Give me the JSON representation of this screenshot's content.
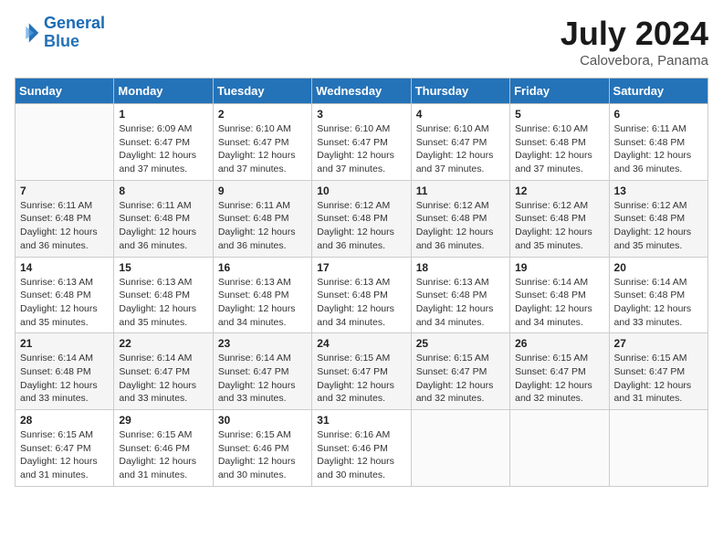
{
  "header": {
    "logo_line1": "General",
    "logo_line2": "Blue",
    "month": "July 2024",
    "location": "Calovebora, Panama"
  },
  "days_of_week": [
    "Sunday",
    "Monday",
    "Tuesday",
    "Wednesday",
    "Thursday",
    "Friday",
    "Saturday"
  ],
  "weeks": [
    [
      {
        "day": "",
        "sunrise": "",
        "sunset": "",
        "daylight": ""
      },
      {
        "day": "1",
        "sunrise": "6:09 AM",
        "sunset": "6:47 PM",
        "daylight": "12 hours and 37 minutes."
      },
      {
        "day": "2",
        "sunrise": "6:10 AM",
        "sunset": "6:47 PM",
        "daylight": "12 hours and 37 minutes."
      },
      {
        "day": "3",
        "sunrise": "6:10 AM",
        "sunset": "6:47 PM",
        "daylight": "12 hours and 37 minutes."
      },
      {
        "day": "4",
        "sunrise": "6:10 AM",
        "sunset": "6:47 PM",
        "daylight": "12 hours and 37 minutes."
      },
      {
        "day": "5",
        "sunrise": "6:10 AM",
        "sunset": "6:48 PM",
        "daylight": "12 hours and 37 minutes."
      },
      {
        "day": "6",
        "sunrise": "6:11 AM",
        "sunset": "6:48 PM",
        "daylight": "12 hours and 36 minutes."
      }
    ],
    [
      {
        "day": "7",
        "sunrise": "6:11 AM",
        "sunset": "6:48 PM",
        "daylight": "12 hours and 36 minutes."
      },
      {
        "day": "8",
        "sunrise": "6:11 AM",
        "sunset": "6:48 PM",
        "daylight": "12 hours and 36 minutes."
      },
      {
        "day": "9",
        "sunrise": "6:11 AM",
        "sunset": "6:48 PM",
        "daylight": "12 hours and 36 minutes."
      },
      {
        "day": "10",
        "sunrise": "6:12 AM",
        "sunset": "6:48 PM",
        "daylight": "12 hours and 36 minutes."
      },
      {
        "day": "11",
        "sunrise": "6:12 AM",
        "sunset": "6:48 PM",
        "daylight": "12 hours and 36 minutes."
      },
      {
        "day": "12",
        "sunrise": "6:12 AM",
        "sunset": "6:48 PM",
        "daylight": "12 hours and 35 minutes."
      },
      {
        "day": "13",
        "sunrise": "6:12 AM",
        "sunset": "6:48 PM",
        "daylight": "12 hours and 35 minutes."
      }
    ],
    [
      {
        "day": "14",
        "sunrise": "6:13 AM",
        "sunset": "6:48 PM",
        "daylight": "12 hours and 35 minutes."
      },
      {
        "day": "15",
        "sunrise": "6:13 AM",
        "sunset": "6:48 PM",
        "daylight": "12 hours and 35 minutes."
      },
      {
        "day": "16",
        "sunrise": "6:13 AM",
        "sunset": "6:48 PM",
        "daylight": "12 hours and 34 minutes."
      },
      {
        "day": "17",
        "sunrise": "6:13 AM",
        "sunset": "6:48 PM",
        "daylight": "12 hours and 34 minutes."
      },
      {
        "day": "18",
        "sunrise": "6:13 AM",
        "sunset": "6:48 PM",
        "daylight": "12 hours and 34 minutes."
      },
      {
        "day": "19",
        "sunrise": "6:14 AM",
        "sunset": "6:48 PM",
        "daylight": "12 hours and 34 minutes."
      },
      {
        "day": "20",
        "sunrise": "6:14 AM",
        "sunset": "6:48 PM",
        "daylight": "12 hours and 33 minutes."
      }
    ],
    [
      {
        "day": "21",
        "sunrise": "6:14 AM",
        "sunset": "6:48 PM",
        "daylight": "12 hours and 33 minutes."
      },
      {
        "day": "22",
        "sunrise": "6:14 AM",
        "sunset": "6:47 PM",
        "daylight": "12 hours and 33 minutes."
      },
      {
        "day": "23",
        "sunrise": "6:14 AM",
        "sunset": "6:47 PM",
        "daylight": "12 hours and 33 minutes."
      },
      {
        "day": "24",
        "sunrise": "6:15 AM",
        "sunset": "6:47 PM",
        "daylight": "12 hours and 32 minutes."
      },
      {
        "day": "25",
        "sunrise": "6:15 AM",
        "sunset": "6:47 PM",
        "daylight": "12 hours and 32 minutes."
      },
      {
        "day": "26",
        "sunrise": "6:15 AM",
        "sunset": "6:47 PM",
        "daylight": "12 hours and 32 minutes."
      },
      {
        "day": "27",
        "sunrise": "6:15 AM",
        "sunset": "6:47 PM",
        "daylight": "12 hours and 31 minutes."
      }
    ],
    [
      {
        "day": "28",
        "sunrise": "6:15 AM",
        "sunset": "6:47 PM",
        "daylight": "12 hours and 31 minutes."
      },
      {
        "day": "29",
        "sunrise": "6:15 AM",
        "sunset": "6:46 PM",
        "daylight": "12 hours and 31 minutes."
      },
      {
        "day": "30",
        "sunrise": "6:15 AM",
        "sunset": "6:46 PM",
        "daylight": "12 hours and 30 minutes."
      },
      {
        "day": "31",
        "sunrise": "6:16 AM",
        "sunset": "6:46 PM",
        "daylight": "12 hours and 30 minutes."
      },
      {
        "day": "",
        "sunrise": "",
        "sunset": "",
        "daylight": ""
      },
      {
        "day": "",
        "sunrise": "",
        "sunset": "",
        "daylight": ""
      },
      {
        "day": "",
        "sunrise": "",
        "sunset": "",
        "daylight": ""
      }
    ]
  ],
  "labels": {
    "sunrise_prefix": "Sunrise: ",
    "sunset_prefix": "Sunset: ",
    "daylight_prefix": "Daylight: "
  }
}
